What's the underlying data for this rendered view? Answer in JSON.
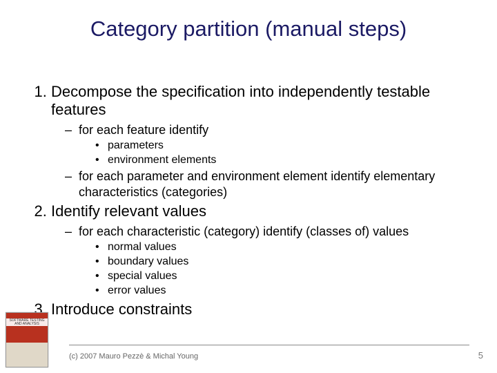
{
  "title": "Category partition (manual steps)",
  "items": [
    {
      "text": "Decompose the specification into independently testable features",
      "sub": [
        {
          "text": "for each feature identify",
          "bullets": [
            "parameters",
            "environment elements"
          ]
        },
        {
          "text": "for each parameter and environment element identify elementary characteristics (categories)"
        }
      ]
    },
    {
      "text": "Identify relevant values",
      "sub": [
        {
          "text": "for each characteristic (category) identify (classes of) values",
          "bullets": [
            "normal values",
            "boundary values",
            "special values",
            "error values"
          ]
        }
      ]
    },
    {
      "text": "Introduce constraints"
    }
  ],
  "footer": {
    "copyright": "(c) 2007 Mauro Pezzè & Michal Young",
    "page": "5"
  },
  "corner_label": "SOFTWARE TESTING AND ANALYSIS"
}
